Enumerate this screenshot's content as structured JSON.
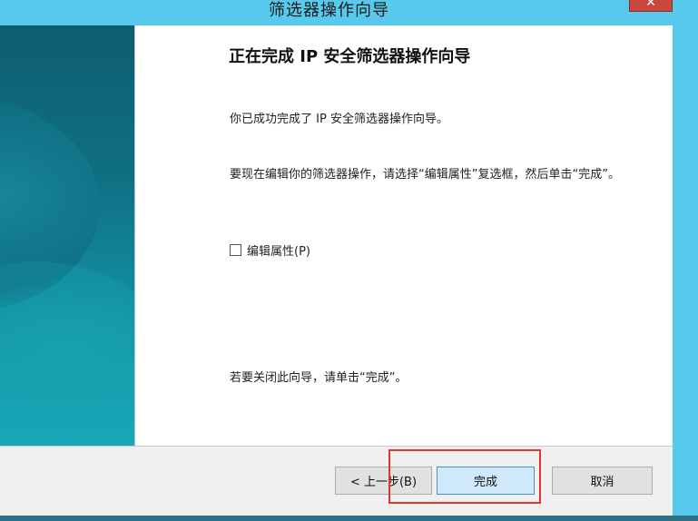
{
  "window": {
    "title": "筛选器操作向导",
    "close_glyph": "✕"
  },
  "wizard": {
    "heading": "正在完成 IP 安全筛选器操作向导",
    "success_text": "你已成功完成了 IP 安全筛选器操作向导。",
    "edit_instruction": "要现在编辑你的筛选器操作，请选择“编辑属性”复选框，然后单击“完成”。",
    "edit_properties": {
      "label": "编辑属性(P)",
      "checked": false
    },
    "close_instruction": "若要关闭此向导，请单击“完成”。"
  },
  "buttons": {
    "back": "< 上一步(B)",
    "finish": "完成",
    "cancel": "取消"
  },
  "colors": {
    "titlebar": "#56c9ec",
    "banner_top": "#0e5e70",
    "banner_bottom": "#16aab8",
    "highlight": "#e5342f",
    "finish_button": "#cfe9fb"
  },
  "icons": [
    "close-icon",
    "checkbox-icon"
  ]
}
